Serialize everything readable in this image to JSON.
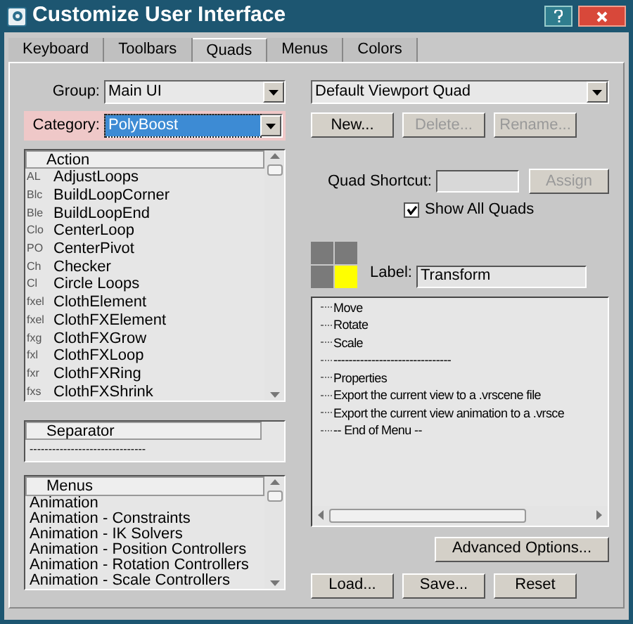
{
  "window": {
    "title": "Customize User Interface"
  },
  "tabs": [
    {
      "label": "Keyboard",
      "selected": false
    },
    {
      "label": "Toolbars",
      "selected": false
    },
    {
      "label": "Quads",
      "selected": true
    },
    {
      "label": "Menus",
      "selected": false
    },
    {
      "label": "Colors",
      "selected": false
    }
  ],
  "group": {
    "label": "Group:",
    "value": "Main UI"
  },
  "category": {
    "label": "Category:",
    "value": "PolyBoost",
    "highlighted": true
  },
  "actions": {
    "heading": "Action",
    "rows": [
      {
        "icon": "AL",
        "label": "AdjustLoops"
      },
      {
        "icon": "Blc",
        "label": "BuildLoopCorner"
      },
      {
        "icon": "Ble",
        "label": "BuildLoopEnd"
      },
      {
        "icon": "Clo",
        "label": "CenterLoop"
      },
      {
        "icon": "PO",
        "label": "CenterPivot"
      },
      {
        "icon": "Ch",
        "label": "Checker"
      },
      {
        "icon": "Cl",
        "label": "Circle Loops"
      },
      {
        "icon": "fxel",
        "label": "ClothElement"
      },
      {
        "icon": "fxel",
        "label": "ClothFXElement"
      },
      {
        "icon": "fxg",
        "label": "ClothFXGrow"
      },
      {
        "icon": "fxl",
        "label": "ClothFXLoop"
      },
      {
        "icon": "fxr",
        "label": "ClothFXRing"
      },
      {
        "icon": "fxs",
        "label": "ClothFXShrink"
      }
    ]
  },
  "separator": {
    "heading": "Separator",
    "rows": [
      "-------------------------------"
    ]
  },
  "menus": {
    "heading": "Menus",
    "rows": [
      "Animation",
      "Animation - Constraints",
      "Animation - IK Solvers",
      "Animation - Position Controllers",
      "Animation - Rotation Controllers",
      "Animation - Scale Controllers"
    ]
  },
  "quad_select": {
    "value": "Default Viewport Quad"
  },
  "quad_buttons": [
    {
      "label": "New...",
      "disabled": false
    },
    {
      "label": "Delete...",
      "disabled": true
    },
    {
      "label": "Rename...",
      "disabled": true
    }
  ],
  "shortcut": {
    "label": "Quad Shortcut:",
    "button": "Assign",
    "button_disabled": true
  },
  "show_all": {
    "label": "Show All Quads",
    "checked": true
  },
  "quadrants": [
    {
      "selected": false
    },
    {
      "selected": false
    },
    {
      "selected": false
    },
    {
      "selected": true
    }
  ],
  "quad_label": {
    "label": "Label:",
    "value": "Transform"
  },
  "quad_items": [
    "Move",
    "Rotate",
    "Scale",
    "-------------------------------",
    "Properties",
    "Export the current view to a .vrscene file",
    "Export the current view animation to a .vrsce",
    "-- End of Menu --"
  ],
  "advanced_button": "Advanced Options...",
  "bottom_buttons": [
    "Load...",
    "Save...",
    "Reset"
  ]
}
